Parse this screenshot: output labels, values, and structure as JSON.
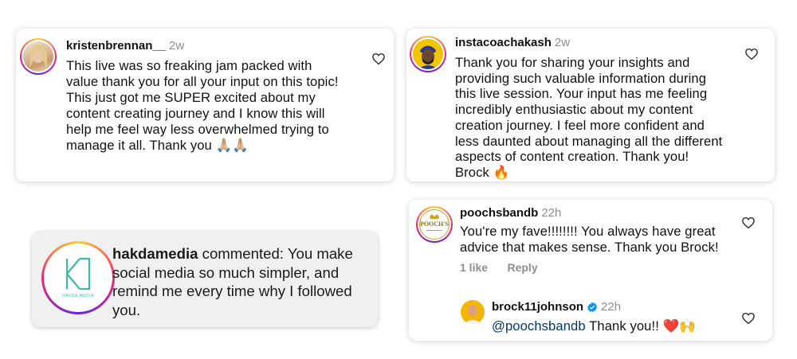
{
  "comments": [
    {
      "username": "kristenbrennan__",
      "time": "2w",
      "text": "This live was so freaking jam packed with value thank you for all your input on this topic! This just got me SUPER excited about my content creating journey and I know this will help me feel way less overwhelmed trying to manage it all. Thank you",
      "emoji": "🙏🏼🙏🏼",
      "avatar_icon": "avatar-photo"
    },
    {
      "username": "instacoachakash",
      "time": "2w",
      "text": "Thank you for sharing your insights and providing such valuable information during this live session. Your input has me feeling incredibly enthusiastic about my content creation journey. I feel more confident and less daunted about managing all the different aspects of content creation. Thank you! Brock",
      "emoji": "🔥",
      "avatar_icon": "avatar-photo"
    },
    {
      "username": "hakdamedia",
      "action": "commented:",
      "text": "You make social media so much simpler, and remind me every time why I followed you.",
      "logo_text": "HAKDA MEDIA",
      "avatar_icon": "hakda-logo"
    },
    {
      "username": "poochsbandb",
      "time": "22h",
      "text": "You're my fave!!!!!!!! You always have great advice that makes sense. Thank you Brock!",
      "likes": "1 like",
      "reply_label": "Reply",
      "logo_text": "POOCH'S",
      "avatar_icon": "poochs-logo",
      "reply": {
        "username": "brock11johnson",
        "verified": true,
        "time": "22h",
        "mention": "@poochsbandb",
        "text": "Thank you!!",
        "emoji": "❤️🙌"
      }
    }
  ],
  "colors": {
    "ring_gradient": [
      "#f9ce34",
      "#ee2a7b",
      "#6228d7"
    ],
    "meta_gray": "#8e8e8e",
    "mention_blue": "#00376b",
    "verified_blue": "#0095f6",
    "hakda_green": "#3fb9a3",
    "poochs_gold": "#c9a227"
  }
}
